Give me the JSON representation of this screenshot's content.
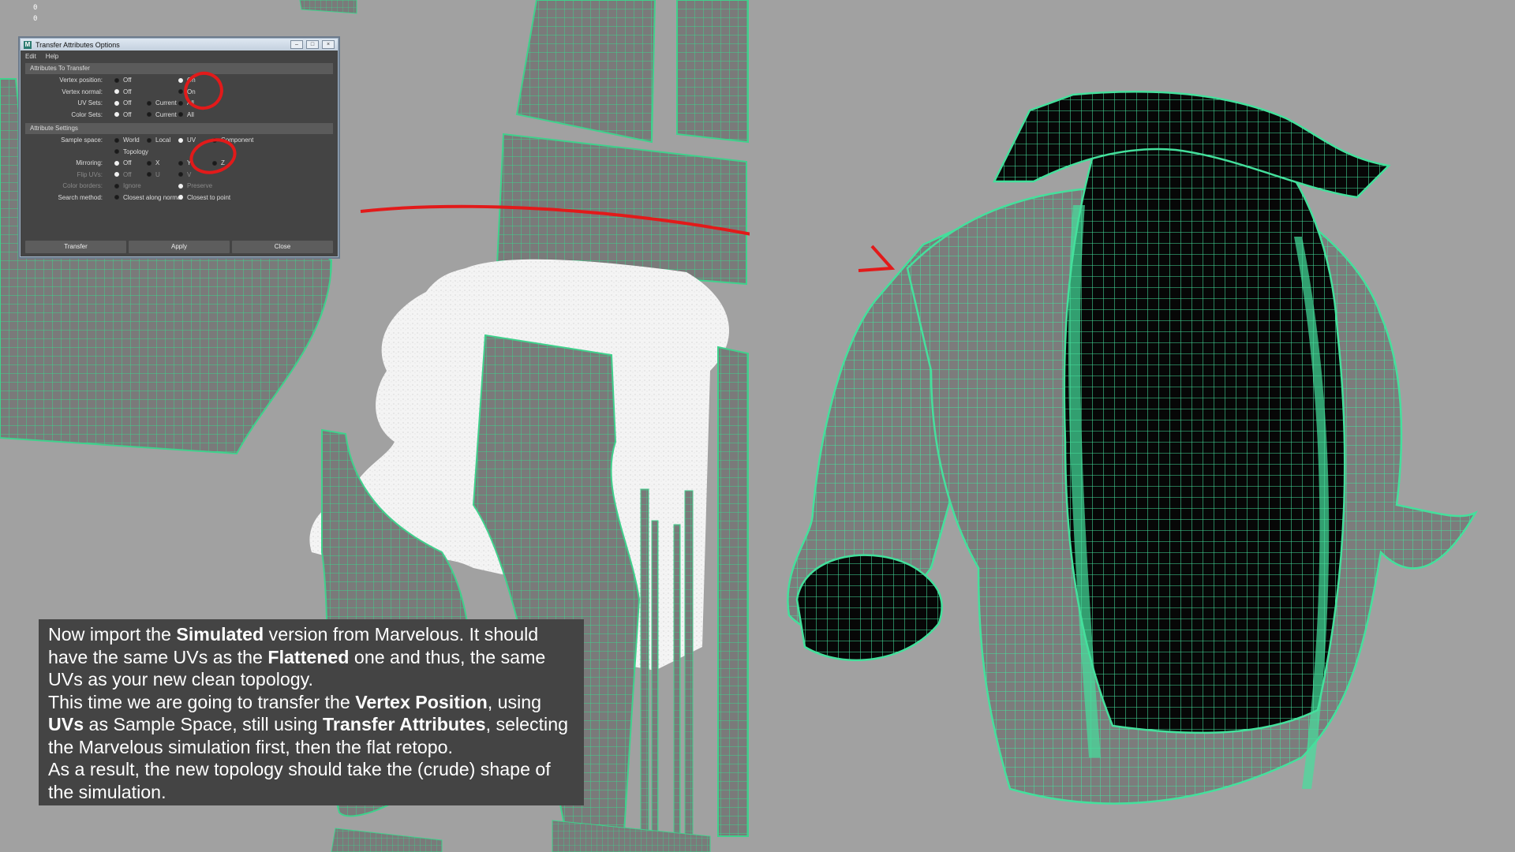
{
  "viewport": {
    "axis_labels": [
      "0",
      "0"
    ]
  },
  "dialog": {
    "title": "Transfer Attributes Options",
    "logo": "M",
    "window_buttons": [
      "minimize-icon",
      "maximize-icon",
      "close-icon"
    ],
    "menu": [
      "Edit",
      "Help"
    ],
    "attributes_section": {
      "header": "Attributes To Transfer",
      "rows": [
        {
          "label": "Vertex position:",
          "options": [
            "Off",
            "On"
          ],
          "selected": "On"
        },
        {
          "label": "Vertex normal:",
          "options": [
            "Off",
            "On"
          ],
          "selected": "Off"
        },
        {
          "label": "UV Sets:",
          "options": [
            "Off",
            "Current",
            "All"
          ],
          "selected": "Off"
        },
        {
          "label": "Color Sets:",
          "options": [
            "Off",
            "Current",
            "All"
          ],
          "selected": "Off"
        }
      ]
    },
    "settings_section": {
      "header": "Attribute Settings",
      "rows": [
        {
          "label": "Sample space:",
          "options": [
            "World",
            "Local",
            "UV",
            "Component"
          ],
          "selected": "UV"
        },
        {
          "label": "",
          "options": [
            "Topology"
          ],
          "selected": ""
        },
        {
          "label": "Mirroring:",
          "options": [
            "Off",
            "X",
            "Y",
            "Z"
          ],
          "selected": "Off"
        },
        {
          "label": "Flip UVs:",
          "options": [
            "Off",
            "U",
            "V"
          ],
          "selected": "Off",
          "disabled": true
        },
        {
          "label": "Color borders:",
          "options": [
            "Ignore",
            "Preserve"
          ],
          "selected": "Preserve",
          "disabled": true
        },
        {
          "label": "Search method:",
          "options": [
            "Closest along normal",
            "Closest to point"
          ],
          "selected": "Closest to point"
        }
      ]
    },
    "buttons": [
      "Transfer",
      "Apply",
      "Close"
    ]
  },
  "caption": {
    "paragraphs": [
      [
        {
          "t": "Now import the "
        },
        {
          "t": "Simulated",
          "b": true
        },
        {
          "t": " version from Marvelous. It should"
        }
      ],
      [
        {
          "t": "have the same UVs as the "
        },
        {
          "t": "Flattened",
          "b": true
        },
        {
          "t": " one and thus, the same"
        }
      ],
      [
        {
          "t": "UVs as your new clean topology."
        }
      ],
      [
        {
          "t": "This time we are going to transfer the "
        },
        {
          "t": "Vertex Position",
          "b": true
        },
        {
          "t": ", using"
        }
      ],
      [
        {
          "t": "UVs",
          "b": true
        },
        {
          "t": " as Sample Space, still using "
        },
        {
          "t": "Transfer Attributes",
          "b": true
        },
        {
          "t": ", selecting"
        }
      ],
      [
        {
          "t": "the Marvelous simulation first, then the flat retopo."
        }
      ],
      [
        {
          "t": "As a result, the new topology should take the (crude) shape of"
        }
      ],
      [
        {
          "t": "the simulation."
        }
      ]
    ]
  },
  "colors": {
    "background": "#a1a1a1",
    "wire": "#4cd99a",
    "annotation": "#e21a1a"
  }
}
